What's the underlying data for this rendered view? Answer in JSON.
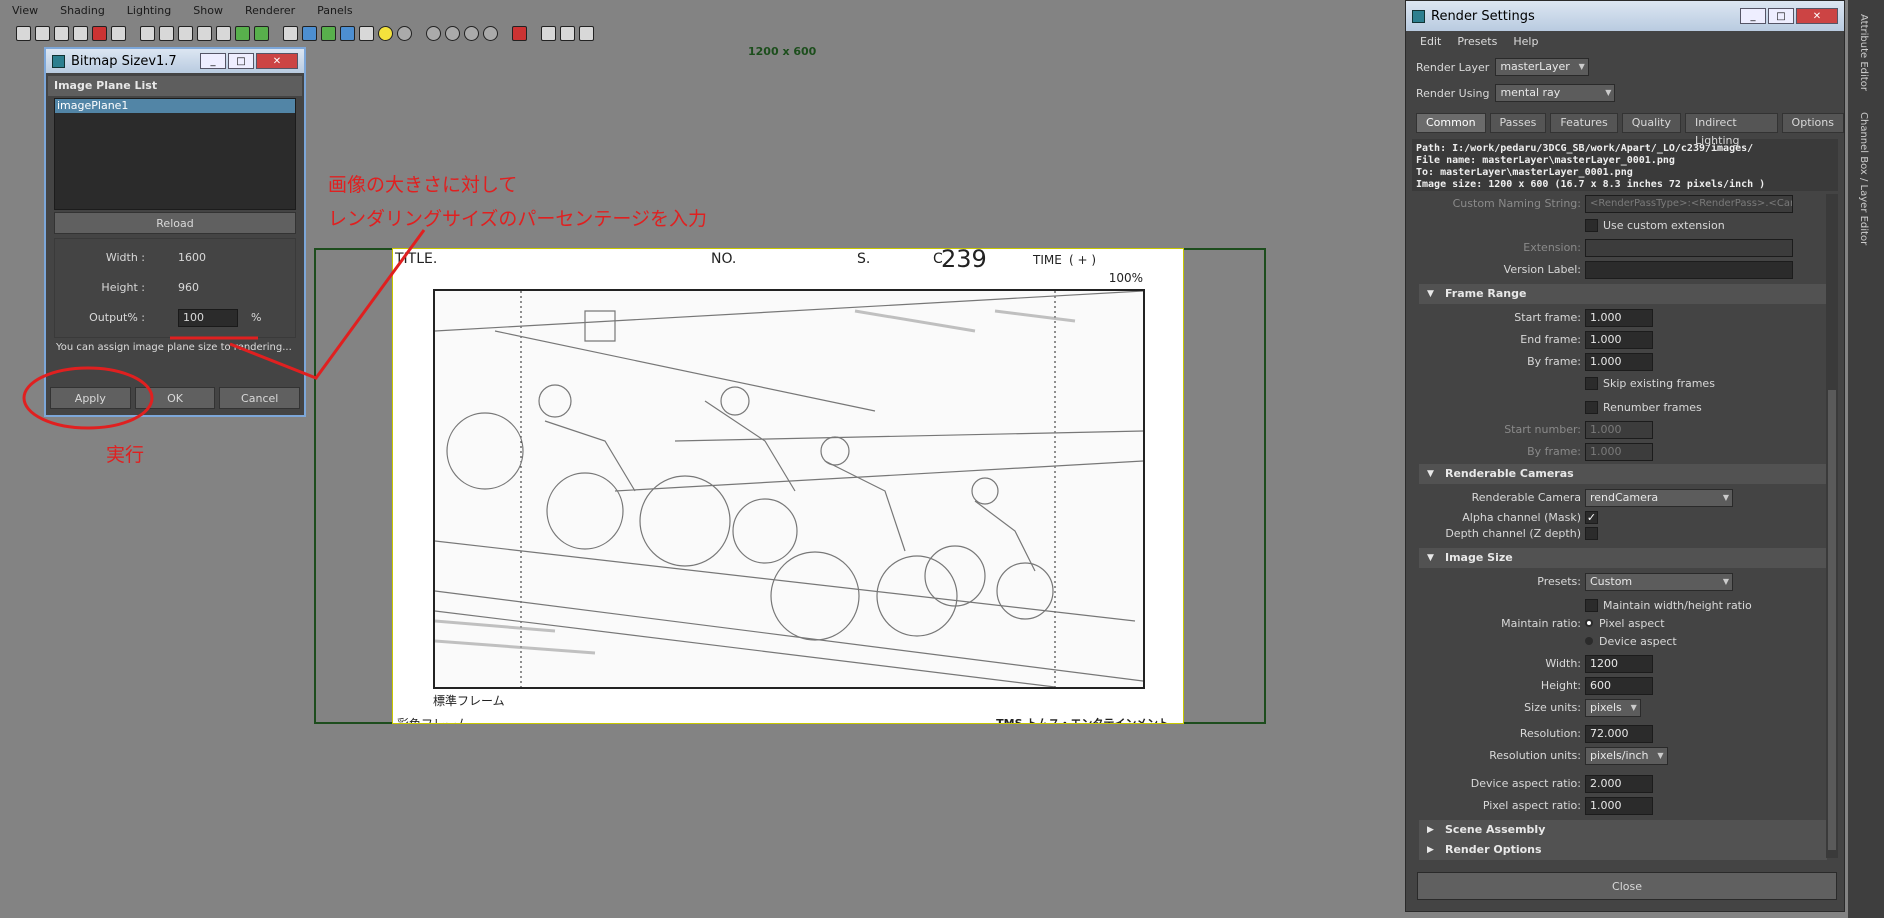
{
  "menu": [
    "View",
    "Shading",
    "Lighting",
    "Show",
    "Renderer",
    "Panels"
  ],
  "viewport": {
    "resolution_label": "1200 x 600",
    "sheet": {
      "title": "TITLE.",
      "no": "NO.",
      "s": "S.",
      "c": "C",
      "cut": "239",
      "time": "TIME",
      "time_mark": "(     +     )",
      "percent": "100%",
      "standard_frame": "標準フレーム",
      "color_frame": "彩色フレーム",
      "company": "TMS トムス・エンタテインメント"
    }
  },
  "bitmap": {
    "title": "Bitmap Sizev1.7",
    "list_header": "Image Plane List",
    "list_items": [
      "imagePlane1"
    ],
    "reload": "Reload",
    "width_label": "Width :",
    "width_value": "1600",
    "height_label": "Height :",
    "height_value": "960",
    "output_label": "Output% :",
    "output_value": "100",
    "output_unit": "%",
    "hint": "You can assign image plane size to rendering...",
    "apply": "Apply",
    "ok": "OK",
    "cancel": "Cancel"
  },
  "annotations": {
    "line1": "画像の大きさに対して",
    "line2": "レンダリングサイズのパーセンテージを入力",
    "execute": "実行"
  },
  "render": {
    "title": "Render Settings",
    "menu": [
      "Edit",
      "Presets",
      "Help"
    ],
    "layer_label": "Render Layer",
    "layer_value": "masterLayer",
    "using_label": "Render Using",
    "using_value": "mental ray",
    "tabs": [
      "Common",
      "Passes",
      "Features",
      "Quality",
      "Indirect Lighting",
      "Options"
    ],
    "info": [
      "Path: I:/work/pedaru/3DCG_SB/work/Apart/_LO/c239/images/",
      "File name:  masterLayer\\masterLayer_0001.png",
      "To:         masterLayer\\masterLayer_0001.png",
      "Image size: 1200 x 600 (16.7 x 8.3 inches 72 pixels/inch )"
    ],
    "custom_naming_label": "Custom Naming String:",
    "custom_naming_value": "<RenderPassType>:<RenderPass>.<Camera>",
    "use_custom_ext": "Use custom extension",
    "extension_label": "Extension:",
    "version_label": "Version Label:",
    "frame_range": "Frame Range",
    "start_frame_label": "Start frame:",
    "start_frame": "1.000",
    "end_frame_label": "End frame:",
    "end_frame": "1.000",
    "by_frame_label": "By frame:",
    "by_frame": "1.000",
    "skip_existing": "Skip existing frames",
    "renumber": "Renumber frames",
    "start_number_label": "Start number:",
    "start_number": "1.000",
    "by_frame2_label": "By frame:",
    "by_frame2": "1.000",
    "renderable_cameras": "Renderable Cameras",
    "renderable_camera_label": "Renderable Camera",
    "renderable_camera": "rendCamera",
    "alpha_label": "Alpha channel (Mask)",
    "depth_label": "Depth channel (Z depth)",
    "image_size": "Image Size",
    "presets_label": "Presets:",
    "presets_value": "Custom",
    "maintain_wh": "Maintain width/height ratio",
    "maintain_ratio_label": "Maintain ratio:",
    "pixel_aspect": "Pixel aspect",
    "device_aspect": "Device aspect",
    "width_label": "Width:",
    "width": "1200",
    "height_label": "Height:",
    "height": "600",
    "size_units_label": "Size units:",
    "size_units": "pixels",
    "resolution_label": "Resolution:",
    "resolution": "72.000",
    "res_units_label": "Resolution units:",
    "res_units": "pixels/inch",
    "device_aspect_label": "Device aspect ratio:",
    "device_aspect_value": "2.000",
    "pixel_aspect_label": "Pixel aspect ratio:",
    "pixel_aspect_value": "1.000",
    "scene_assembly": "Scene Assembly",
    "render_options": "Render Options",
    "close": "Close"
  },
  "side_tabs": [
    "Attribute Editor",
    "Channel Box / Layer Editor"
  ],
  "colors": {
    "annotation": "#e02020",
    "selection": "#5285a6"
  }
}
